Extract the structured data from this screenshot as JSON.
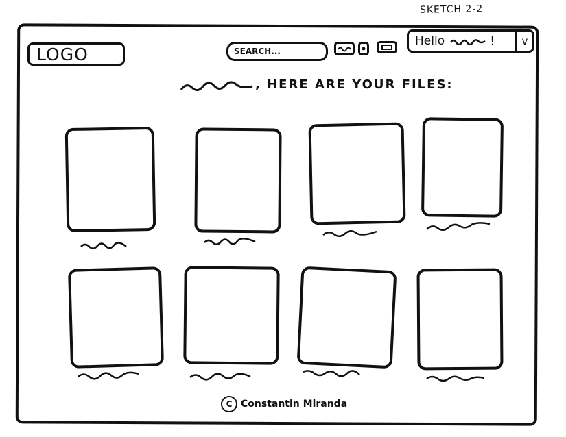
{
  "sketch": {
    "label": "SKETCH 2-2"
  },
  "header": {
    "logo": "LOGO",
    "search_placeholder": "SEARCH...",
    "greeting": "Hello",
    "greeting_end": "!",
    "menu_caret": "v",
    "icons": [
      "squiggle-icon",
      "dot-icon",
      "box-icon",
      "chevron-down-icon"
    ]
  },
  "main": {
    "heading": ", HERE ARE YOUR FILES:"
  },
  "footer": {
    "credit": "Constantin Miranda"
  },
  "files": [
    {
      "label": "file-1"
    },
    {
      "label": "file-2"
    },
    {
      "label": "file-3"
    },
    {
      "label": "file-4"
    },
    {
      "label": "file-5"
    },
    {
      "label": "file-6"
    },
    {
      "label": "file-7"
    },
    {
      "label": "file-8"
    }
  ]
}
